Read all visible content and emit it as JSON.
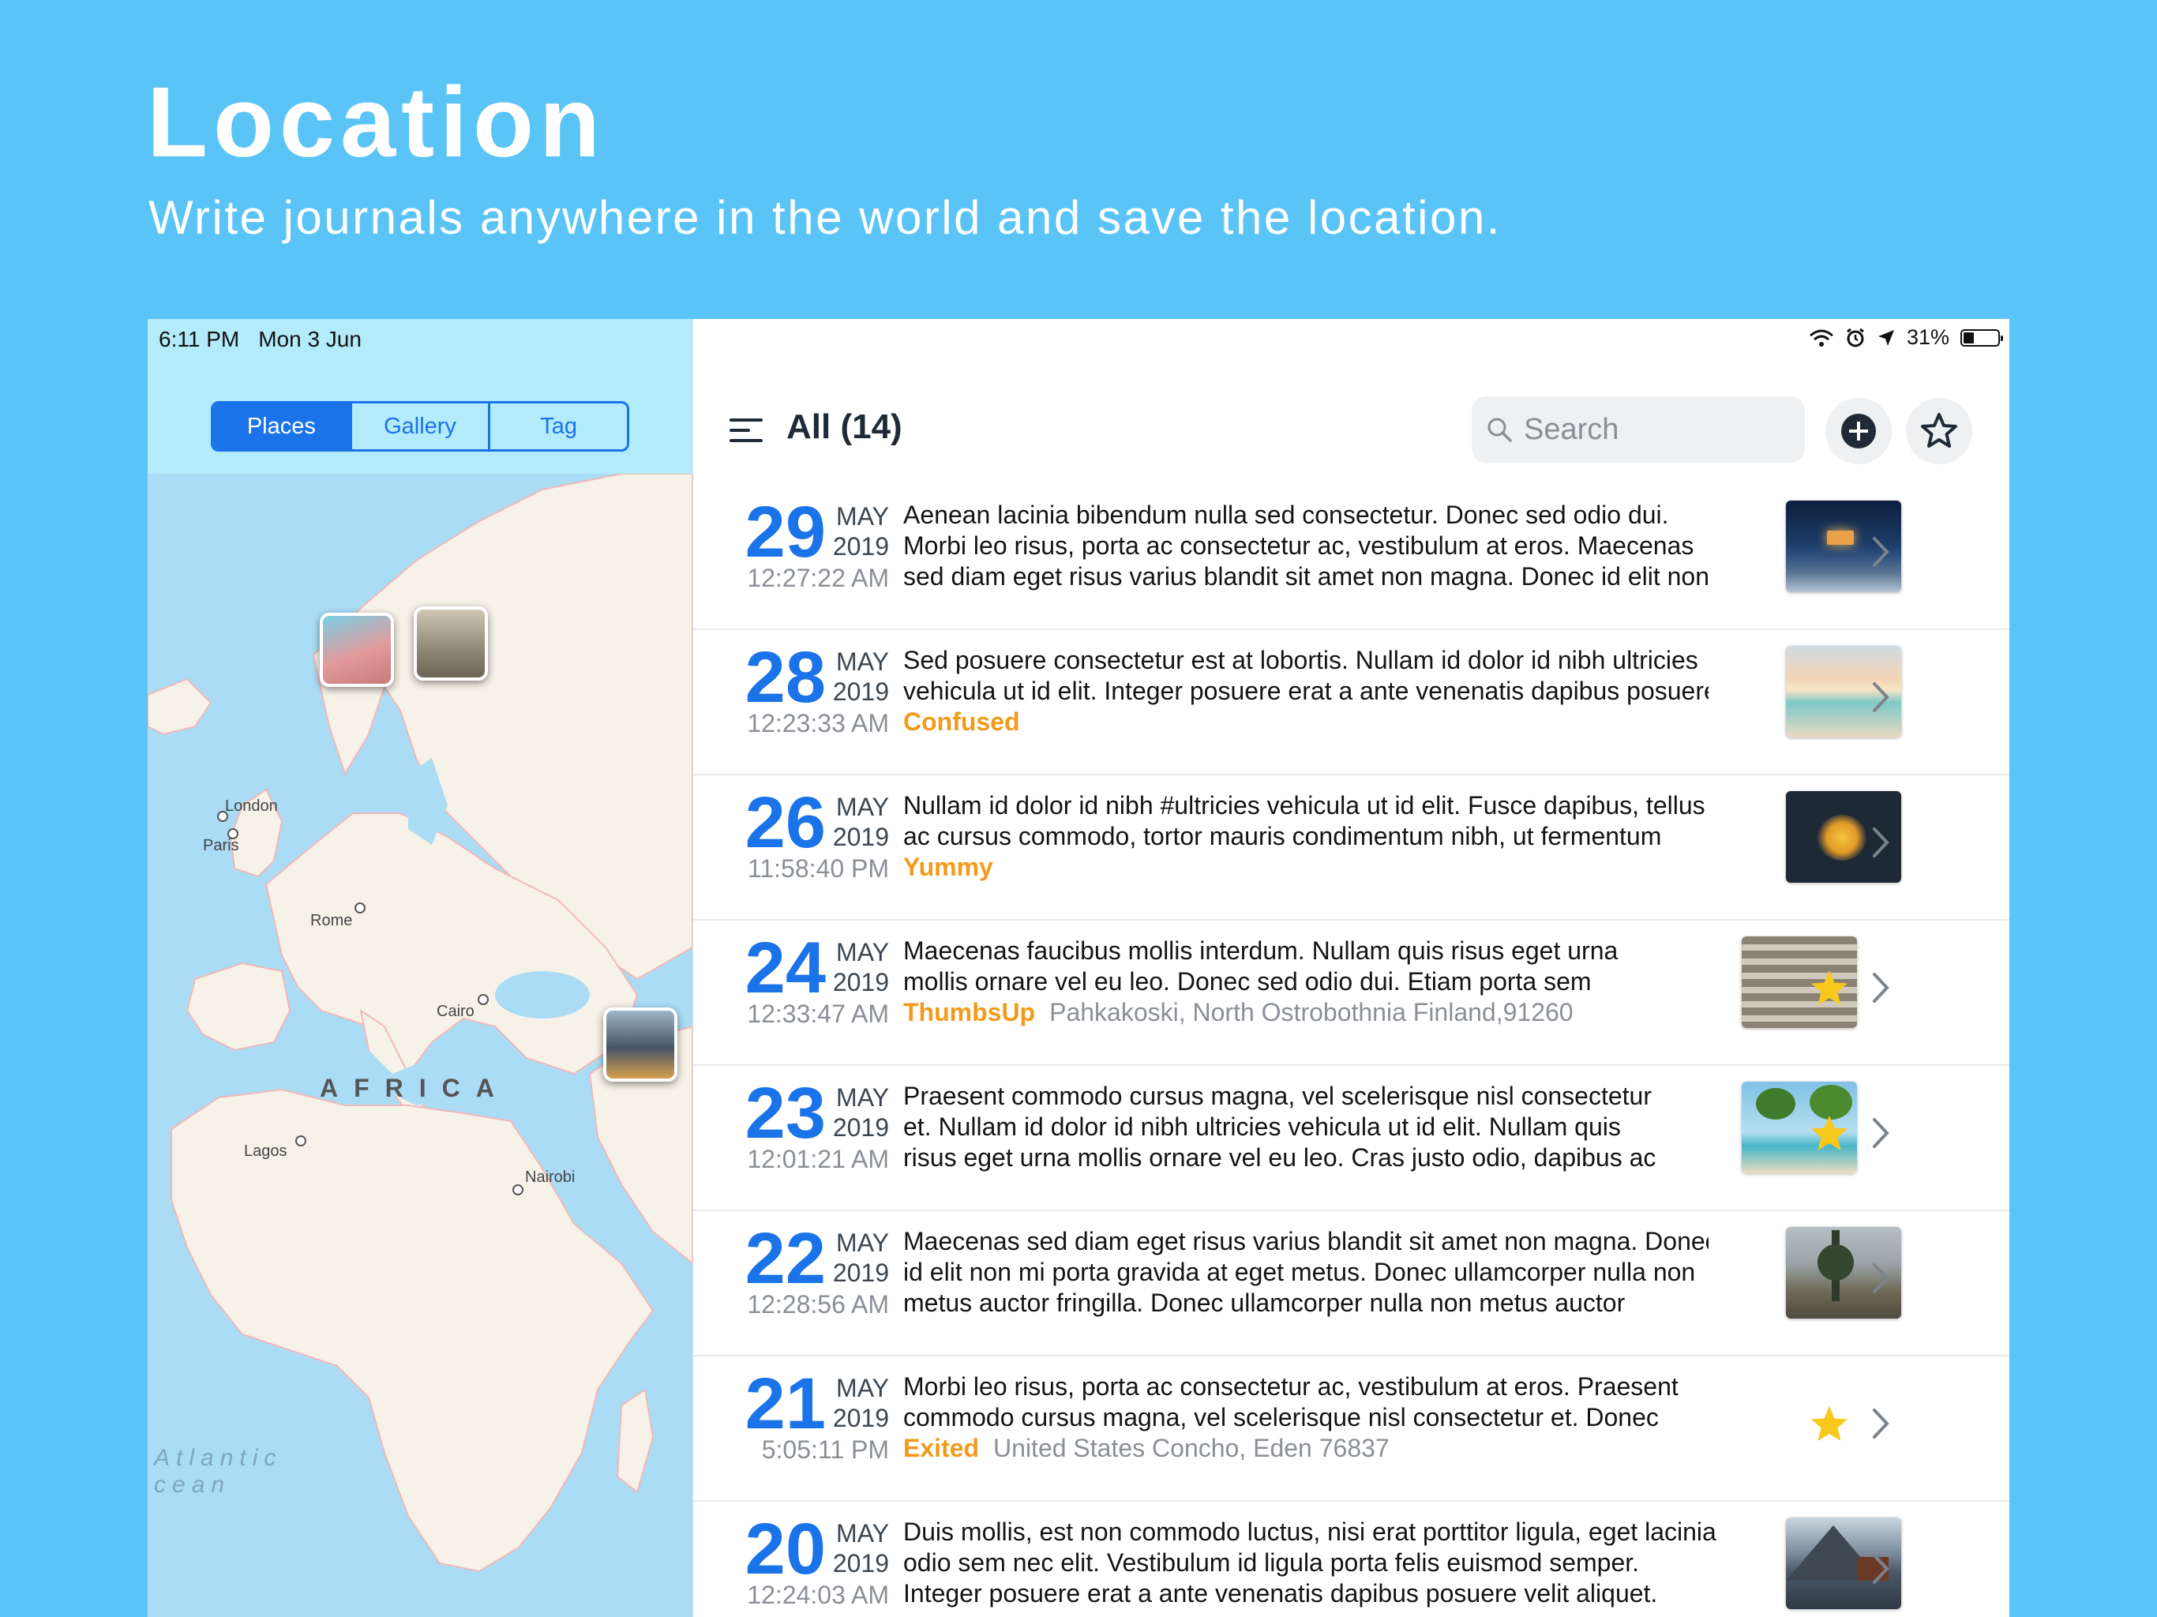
{
  "headline": "Location",
  "subhead": "Write journals anywhere in the world and save the location.",
  "status": {
    "time": "6:11 PM",
    "date": "Mon 3 Jun",
    "battery": "31%"
  },
  "segments": [
    "Places",
    "Gallery",
    "Tag"
  ],
  "map": {
    "cities": [
      "London",
      "Paris",
      "Rome",
      "Cairo",
      "Lagos",
      "Nairobi"
    ],
    "region": "AFRICA",
    "ocean": "Atlantic\ncean"
  },
  "header": {
    "title": "All (14)",
    "search_placeholder": "Search"
  },
  "entries": [
    {
      "day": "29",
      "month": "MAY",
      "year": "2019",
      "time": "12:27:22 AM",
      "lines": [
        "Aenean lacinia bibendum nulla sed consectetur. Donec sed odio dui.",
        "Morbi leo risus, porta ac consectetur ac, vestibulum at eros. Maecenas",
        "sed diam eget risus varius blandit sit amet non magna. Donec id elit non"
      ],
      "mood": "",
      "location": "",
      "starred": false,
      "thumb": "cabin-night"
    },
    {
      "day": "28",
      "month": "MAY",
      "year": "2019",
      "time": "12:23:33 AM",
      "lines": [
        "Sed posuere consectetur est at lobortis. Nullam id dolor id nibh ultricies",
        "vehicula ut id elit. Integer posuere erat a ante venenatis dapibus posuere"
      ],
      "mood": "Confused",
      "location": "",
      "starred": false,
      "thumb": "beach-sunset"
    },
    {
      "day": "26",
      "month": "MAY",
      "year": "2019",
      "time": "11:58:40 PM",
      "lines": [
        "Nullam id dolor id nibh #ultricies vehicula ut id elit. Fusce dapibus, tellus",
        "ac cursus commodo, tortor mauris condimentum nibh, ut fermentum"
      ],
      "mood": "Yummy",
      "location": "",
      "starred": false,
      "thumb": "food-pan"
    },
    {
      "day": "24",
      "month": "MAY",
      "year": "2019",
      "time": "12:33:47 AM",
      "lines": [
        "Maecenas faucibus mollis interdum. Nullam quis risus eget urna",
        "mollis ornare vel eu leo. Donec sed odio dui. Etiam porta sem"
      ],
      "mood": "ThumbsUp",
      "location": "Pahkakoski, North Ostrobothnia Finland,91260",
      "starred": true,
      "thumb": "rail-track"
    },
    {
      "day": "23",
      "month": "MAY",
      "year": "2019",
      "time": "12:01:21 AM",
      "lines": [
        "Praesent commodo cursus magna, vel scelerisque nisl consectetur",
        "et. Nullam id dolor id nibh ultricies vehicula ut id elit. Nullam quis",
        "risus eget urna mollis ornare vel eu leo. Cras justo odio, dapibus ac"
      ],
      "mood": "",
      "location": "",
      "starred": true,
      "thumb": "palm-beach"
    },
    {
      "day": "22",
      "month": "MAY",
      "year": "2019",
      "time": "12:28:56 AM",
      "lines": [
        "Maecenas sed diam eget risus varius blandit sit amet non magna. Donec",
        "id elit non mi porta gravida at eget metus. Donec ullamcorper nulla non",
        "metus auctor fringilla. Donec ullamcorper nulla non metus auctor"
      ],
      "mood": "",
      "location": "",
      "starred": false,
      "thumb": "lake-trees"
    },
    {
      "day": "21",
      "month": "MAY",
      "year": "2019",
      "time": "5:05:11 PM",
      "lines": [
        "Morbi leo risus, porta ac consectetur ac, vestibulum at eros. Praesent",
        "commodo cursus magna, vel scelerisque nisl consectetur et. Donec"
      ],
      "mood": "Exited",
      "location": "United States Concho, Eden 76837",
      "starred": true,
      "thumb": ""
    },
    {
      "day": "20",
      "month": "MAY",
      "year": "2019",
      "time": "12:24:03 AM",
      "lines": [
        "Duis mollis, est non commodo luctus, nisi erat porttitor ligula, eget lacinia",
        "odio sem nec elit. Vestibulum id ligula porta felis euismod semper.",
        "Integer posuere erat a ante venenatis dapibus posuere velit aliquet."
      ],
      "mood": "",
      "location": "",
      "starred": false,
      "thumb": "mountain-lake"
    }
  ]
}
